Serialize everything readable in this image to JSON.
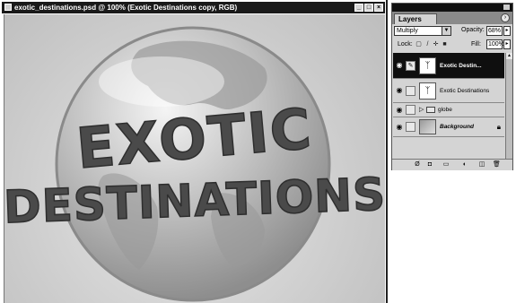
{
  "document": {
    "title": "exotic_destinations.psd @ 100% (Exotic Destinations copy, RGB)",
    "window_buttons": [
      "_",
      "□",
      "×"
    ],
    "artwork_line1": "EXOTIC",
    "artwork_line2": "DESTINATIONS"
  },
  "layers_palette": {
    "tab_label": "Layers",
    "menu_icon": "palette-menu-icon",
    "blend_mode": "Multiply",
    "opacity_label": "Opacity:",
    "opacity_value": "68%",
    "lock_label": "Lock:",
    "fill_label": "Fill:",
    "fill_value": "100%",
    "layers": [
      {
        "name": "Exotic Destin...",
        "selected": true,
        "type": "text-effect"
      },
      {
        "name": "Exotic Destinations",
        "selected": false,
        "type": "text-effect"
      },
      {
        "name": "globe",
        "selected": false,
        "type": "group"
      },
      {
        "name": "Background",
        "selected": false,
        "type": "background",
        "locked": true
      }
    ],
    "footer_icons": [
      "layer-style-icon",
      "mask-icon",
      "new-set-icon",
      "adjustment-layer-icon",
      "new-layer-icon",
      "trash-icon"
    ]
  },
  "colors": {
    "title_bar": "#1a1a1a",
    "palette_bg": "#d4d4d4",
    "selected_row": "#0f0f0f",
    "text_fill": "#4a4a4a"
  }
}
